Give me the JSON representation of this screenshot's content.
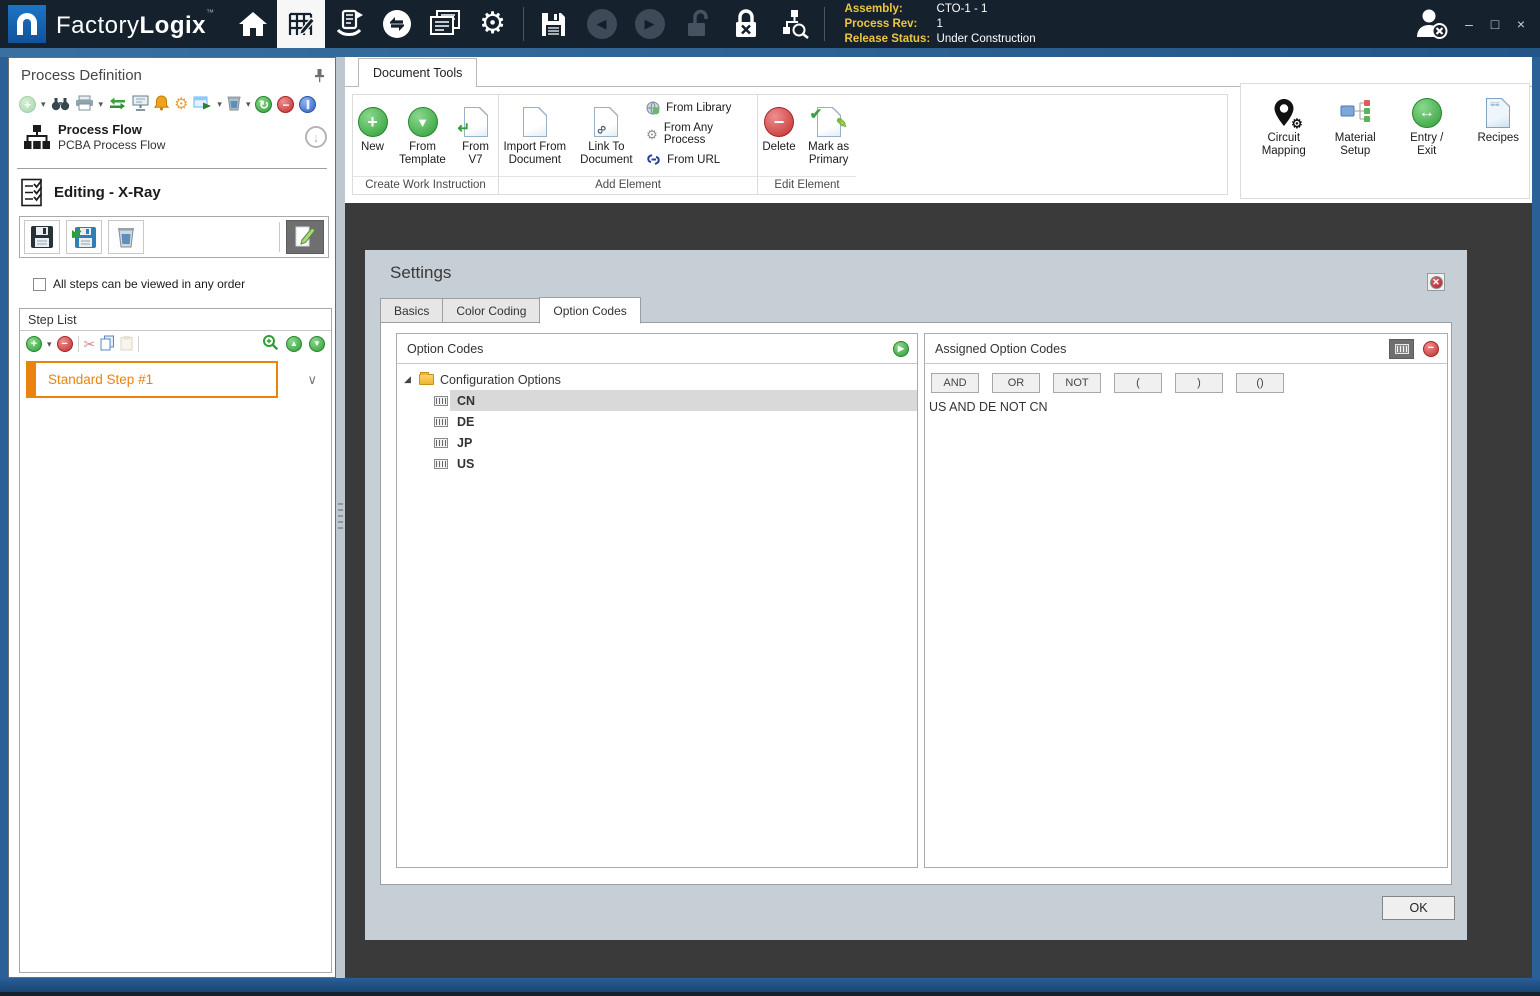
{
  "icons": {
    "minimize": "–",
    "maximize": "□",
    "close": "×",
    "chevron_down": "∨",
    "down_arrow": "↓",
    "dropdown_caret": "▾",
    "expander_expanded": "◢",
    "gear": "⚙",
    "scissors": "✂",
    "pencil": "✎",
    "back_arrow": "◀",
    "forward_arrow": "▶"
  },
  "titlebar": {
    "brand_light": "Factory",
    "brand_bold": "Logix",
    "trademark": "™",
    "info": {
      "assembly_label": "Assembly:",
      "assembly_value": "CTO-1 - 1",
      "process_rev_label": "Process Rev:",
      "process_rev_value": "1",
      "release_status_label": "Release Status:",
      "release_status_value": "Under Construction"
    }
  },
  "left_panel": {
    "title": "Process Definition",
    "process_flow": {
      "title": "Process Flow",
      "subtitle": "PCBA Process Flow"
    },
    "editing_title": "Editing - X-Ray",
    "order_checkbox_label": "All steps can be viewed in any order",
    "step_list": {
      "title": "Step List",
      "steps": [
        {
          "label": "Standard Step #1"
        }
      ]
    }
  },
  "ribbon": {
    "tab_label": "Document Tools",
    "groups": {
      "create": {
        "title": "Create Work Instruction",
        "new_label": "New",
        "from_template_label": "From Template",
        "from_v7_label": "From V7"
      },
      "add": {
        "title": "Add Element",
        "import_label": "Import From Document",
        "link_label": "Link To Document",
        "from_library_label": "From Library",
        "from_any_process_label": "From Any Process",
        "from_url_label": "From URL"
      },
      "edit": {
        "title": "Edit Element",
        "delete_label": "Delete",
        "mark_primary_label": "Mark as Primary"
      }
    },
    "right_buttons": {
      "circuit_mapping": "Circuit Mapping",
      "material_setup": "Material Setup",
      "entry_exit": "Entry / Exit",
      "recipes": "Recipes"
    }
  },
  "settings_dialog": {
    "title": "Settings",
    "tabs": [
      {
        "label": "Basics"
      },
      {
        "label": "Color Coding"
      },
      {
        "label": "Option Codes"
      }
    ],
    "active_tab": "Option Codes",
    "option_codes_panel": {
      "header": "Option Codes",
      "tree": {
        "root_label": "Configuration Options",
        "items": [
          {
            "label": "CN",
            "selected": true
          },
          {
            "label": "DE",
            "selected": false
          },
          {
            "label": "JP",
            "selected": false
          },
          {
            "label": "US",
            "selected": false
          }
        ]
      }
    },
    "assigned_panel": {
      "header": "Assigned Option Codes",
      "operator_buttons": [
        {
          "label": "AND"
        },
        {
          "label": "OR"
        },
        {
          "label": "NOT"
        },
        {
          "label": "("
        },
        {
          "label": ")"
        },
        {
          "label": "()"
        }
      ],
      "expression": "US AND DE NOT CN"
    },
    "ok_label": "OK"
  },
  "colors": {
    "topbar_bg": "#16212E",
    "window_border_blue": "#2B5F97",
    "canvas_bg": "#3A3A3A",
    "dialog_bg": "#C6CFD5",
    "accent_orange": "#E8830E",
    "green_icon": "#2F9E36",
    "red_icon": "#C12F2F",
    "yellow_label": "#ECC63E"
  }
}
